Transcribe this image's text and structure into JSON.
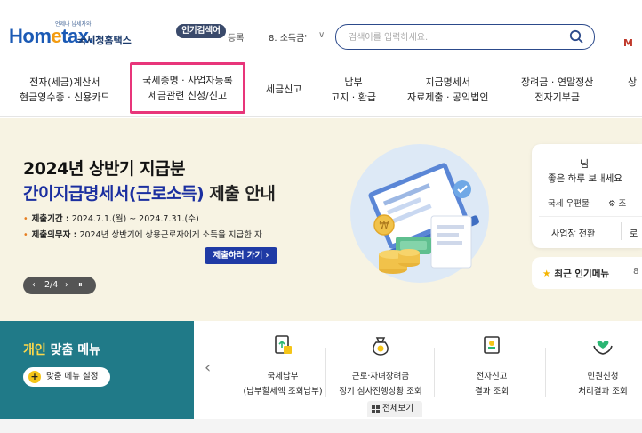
{
  "header": {
    "logo_small": "언제나 납세자와",
    "logo_main_a": "Hom",
    "logo_main_b": "e",
    "logo_main_c": "tax.",
    "logo_sub": "국세청홈택스",
    "popular_badge": "인기검색어",
    "ticker_left": "등록",
    "ticker_main": "8.  소득금'",
    "ticker_chevron": "∨",
    "search_placeholder": "검색어를 입력하세요.",
    "right_letter": "M"
  },
  "gnb": [
    {
      "line1": "전자(세금)계산서",
      "line2": "현금영수증 · 신용카드"
    },
    {
      "line1": "국세증명 · 사업자등록",
      "line2": "세금관련 신청/신고"
    },
    {
      "line1": "세금신고",
      "line2": ""
    },
    {
      "line1": "납부",
      "line2": "고지 · 환급"
    },
    {
      "line1": "지급명세서",
      "line2": "자료제출 · 공익법인"
    },
    {
      "line1": "장려금 · 연말정산",
      "line2": "전자기부금"
    },
    {
      "line1": "상",
      "line2": ""
    }
  ],
  "banner": {
    "title1": "2024년 상반기 지급분",
    "title2_hl": "간이지급명세서(근로소득)",
    "title2_rest": " 제출 안내",
    "line1_key": "제출기간 :",
    "line1_val": " 2024.7.1.(월) ~ 2024.7.31.(수)",
    "line2_key": "제출의무자 :",
    "line2_val": " 2024년 상반기에 상용근로자에게 소득을 지급한 자",
    "submit_label": "제출하러 가기  ›",
    "pager_prev": "‹",
    "pager_text": "2/4",
    "pager_next": "›",
    "pager_pause": "⏸"
  },
  "login": {
    "name": "님",
    "greeting": "좋은 하루 보내세요",
    "mailbox": "국세 우편물",
    "settings": "⚙ 조",
    "switch": "사업장 전환",
    "extra": "로"
  },
  "popular_menu": {
    "label": "최근 인기메뉴",
    "right": "8"
  },
  "custom_menu": {
    "title_hl": "개인",
    "title_rest": " 맞춤 메뉴",
    "setting_label": "맞춤 메뉴 설정",
    "plus": "+"
  },
  "quick": {
    "prev": "‹",
    "items": [
      {
        "t1": "국세납부",
        "t2": "(납부할세액 조회납부)"
      },
      {
        "t1": "근로·자녀장려금",
        "t2": "정기 심사진행상황 조회"
      },
      {
        "t1": "전자신고",
        "t2": "결과 조회"
      },
      {
        "t1": "민원신청",
        "t2": "처리결과 조회"
      }
    ],
    "view_all": "전체보기"
  },
  "colors": {
    "brand_blue": "#1b5ab5",
    "highlight_pink": "#e8357a",
    "banner_bg": "#f7f3e3",
    "teal": "#207a88",
    "submit_blue": "#1f3aa5"
  }
}
